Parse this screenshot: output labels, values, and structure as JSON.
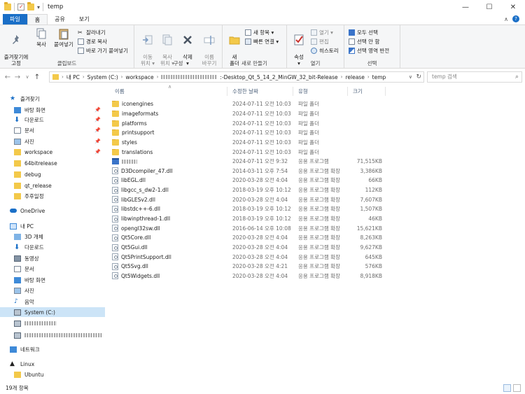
{
  "window": {
    "title": "temp",
    "controls": {
      "minimize": "—",
      "maximize": "☐",
      "close": "✕"
    }
  },
  "ribbon_tabs": [
    "파일",
    "홈",
    "공유",
    "보기"
  ],
  "ribbon": {
    "clipboard": {
      "label": "클립보드",
      "pin": "즐겨찾기에\n고정",
      "copy": "복사",
      "paste": "붙여넣기",
      "cut": "잘라내기",
      "copy_path": "경로 복사",
      "paste_shortcut": "바로 가기 붙여넣기"
    },
    "organize": {
      "label": "구성",
      "move_to": "이동\n위치 ▾",
      "copy_to": "복사\n위치 ▾",
      "delete": "삭제\n▾",
      "rename": "이름\n바꾸기"
    },
    "new": {
      "label": "새로 만들기",
      "new_folder": "새\n폴더",
      "new_item": "새 항목 ▾",
      "easy_access": "빠른 연결 ▾"
    },
    "open": {
      "label": "열기",
      "properties": "속성\n▾",
      "open": "열기 ▾",
      "edit": "편집",
      "history": "히스토리"
    },
    "select": {
      "label": "선택",
      "select_all": "모두 선택",
      "select_none": "선택 안 함",
      "invert": "선택 영역 반전"
    }
  },
  "address": {
    "crumbs": [
      "내 PC",
      "System (C:)",
      "workspace"
    ],
    "crumbs_after": [
      ":-Desktop_Qt_5_14_2_MinGW_32_bit-Release",
      "release",
      "temp"
    ],
    "search_placeholder": "temp 검색"
  },
  "columns": {
    "name": "이름",
    "date": "수정한 날짜",
    "type": "유형",
    "size": "크기"
  },
  "files": [
    {
      "name": "iconengines",
      "date": "2024-07-11 오전 10:03",
      "type": "파일 폴더",
      "size": "",
      "kind": "folder"
    },
    {
      "name": "imageformats",
      "date": "2024-07-11 오전 10:03",
      "type": "파일 폴더",
      "size": "",
      "kind": "folder"
    },
    {
      "name": "platforms",
      "date": "2024-07-11 오전 10:03",
      "type": "파일 폴더",
      "size": "",
      "kind": "folder"
    },
    {
      "name": "printsupport",
      "date": "2024-07-11 오전 10:03",
      "type": "파일 폴더",
      "size": "",
      "kind": "folder"
    },
    {
      "name": "styles",
      "date": "2024-07-11 오전 10:03",
      "type": "파일 폴더",
      "size": "",
      "kind": "folder"
    },
    {
      "name": "translations",
      "date": "2024-07-11 오전 10:03",
      "type": "파일 폴더",
      "size": "",
      "kind": "folder"
    },
    {
      "name": "",
      "date": "2024-07-11 오전 9:32",
      "type": "응용 프로그램",
      "size": "71,515KB",
      "kind": "exe"
    },
    {
      "name": "D3Dcompiler_47.dll",
      "date": "2014-03-11 오후 7:54",
      "type": "응용 프로그램 확장",
      "size": "3,386KB",
      "kind": "dll"
    },
    {
      "name": "libEGL.dll",
      "date": "2020-03-28 오전 4:04",
      "type": "응용 프로그램 확장",
      "size": "66KB",
      "kind": "dll"
    },
    {
      "name": "libgcc_s_dw2-1.dll",
      "date": "2018-03-19 오후 10:12",
      "type": "응용 프로그램 확장",
      "size": "112KB",
      "kind": "dll"
    },
    {
      "name": "libGLESv2.dll",
      "date": "2020-03-28 오전 4:04",
      "type": "응용 프로그램 확장",
      "size": "7,607KB",
      "kind": "dll"
    },
    {
      "name": "libstdc++-6.dll",
      "date": "2018-03-19 오후 10:12",
      "type": "응용 프로그램 확장",
      "size": "1,507KB",
      "kind": "dll"
    },
    {
      "name": "libwinpthread-1.dll",
      "date": "2018-03-19 오후 10:12",
      "type": "응용 프로그램 확장",
      "size": "46KB",
      "kind": "dll"
    },
    {
      "name": "opengl32sw.dll",
      "date": "2016-06-14 오후 10:08",
      "type": "응용 프로그램 확장",
      "size": "15,621KB",
      "kind": "dll"
    },
    {
      "name": "Qt5Core.dll",
      "date": "2020-03-28 오전 4:04",
      "type": "응용 프로그램 확장",
      "size": "8,263KB",
      "kind": "dll"
    },
    {
      "name": "Qt5Gui.dll",
      "date": "2020-03-28 오전 4:04",
      "type": "응용 프로그램 확장",
      "size": "9,627KB",
      "kind": "dll"
    },
    {
      "name": "Qt5PrintSupport.dll",
      "date": "2020-03-28 오전 4:04",
      "type": "응용 프로그램 확장",
      "size": "645KB",
      "kind": "dll"
    },
    {
      "name": "Qt5Svg.dll",
      "date": "2020-03-28 오전 4:21",
      "type": "응용 프로그램 확장",
      "size": "576KB",
      "kind": "dll"
    },
    {
      "name": "Qt5Widgets.dll",
      "date": "2020-03-28 오전 4:04",
      "type": "응용 프로그램 확장",
      "size": "8,918KB",
      "kind": "dll"
    }
  ],
  "nav": {
    "quick_access": "즐겨찾기",
    "quick_items": [
      "바탕 화면",
      "다운로드",
      "문서",
      "사진",
      "workspace",
      "64bitrelease",
      "debug",
      "qt_release",
      "주후일정"
    ],
    "onedrive": "OneDrive",
    "this_pc": "내 PC",
    "pc_items": [
      "3D 개체",
      "다운로드",
      "동영상",
      "문서",
      "바탕 화면",
      "사진",
      "음악",
      "System (C:)"
    ],
    "network": "네트워크",
    "linux": "Linux",
    "ubuntu": "Ubuntu"
  },
  "status": {
    "count": "19개 항목"
  },
  "colors": {
    "accent": "#1a6fc7",
    "selected": "#cce4f7",
    "folder": "#f3c94a"
  }
}
